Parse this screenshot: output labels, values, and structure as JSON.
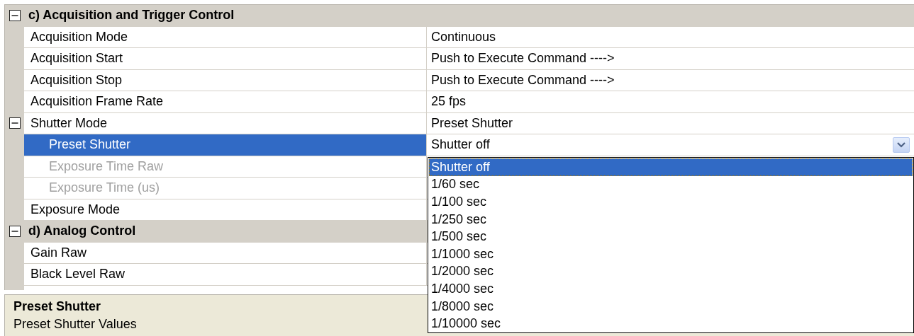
{
  "categories": [
    {
      "title": "c) Acquisition and Trigger Control",
      "expanded": true,
      "properties": [
        {
          "name": "Acquisition Mode",
          "value": "Continuous",
          "selected": false,
          "disabled": false
        },
        {
          "name": "Acquisition Start",
          "value": "Push to Execute Command ---->",
          "selected": false,
          "disabled": false
        },
        {
          "name": "Acquisition Stop",
          "value": "Push to Execute Command ---->",
          "selected": false,
          "disabled": false
        },
        {
          "name": "Acquisition Frame Rate",
          "value": "25 fps",
          "selected": false,
          "disabled": false
        },
        {
          "name": "Shutter Mode",
          "value": "Preset Shutter",
          "selected": false,
          "disabled": false,
          "expanded": true,
          "children": [
            {
              "name": "Preset Shutter",
              "value": "Shutter off",
              "selected": true,
              "disabled": false
            },
            {
              "name": "Exposure Time Raw",
              "selected": false,
              "disabled": true
            },
            {
              "name": "Exposure Time (us)",
              "selected": false,
              "disabled": true
            }
          ]
        },
        {
          "name": "Exposure Mode",
          "selected": false,
          "disabled": false
        }
      ]
    },
    {
      "title": "d) Analog Control",
      "expanded": true,
      "properties": [
        {
          "name": "Gain Raw",
          "selected": false,
          "disabled": false
        },
        {
          "name": "Black Level Raw",
          "selected": false,
          "disabled": false
        }
      ]
    }
  ],
  "dropdown": {
    "options": [
      {
        "label": "Shutter off",
        "selected": true
      },
      {
        "label": "1/60 sec",
        "selected": false
      },
      {
        "label": "1/100 sec",
        "selected": false
      },
      {
        "label": "1/250 sec",
        "selected": false
      },
      {
        "label": "1/500 sec",
        "selected": false
      },
      {
        "label": "1/1000 sec",
        "selected": false
      },
      {
        "label": "1/2000 sec",
        "selected": false
      },
      {
        "label": "1/4000 sec",
        "selected": false
      },
      {
        "label": "1/8000 sec",
        "selected": false
      },
      {
        "label": "1/10000 sec",
        "selected": false
      }
    ]
  },
  "description": {
    "title": "Preset Shutter",
    "text": "Preset Shutter Values"
  }
}
